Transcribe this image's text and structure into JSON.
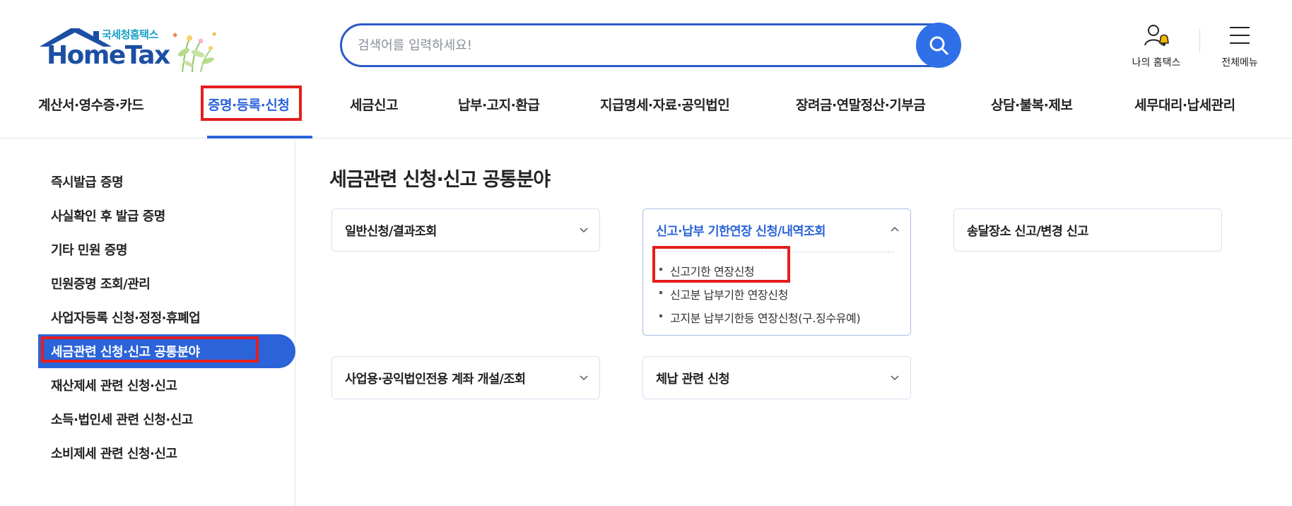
{
  "header": {
    "logo_sub": "국세청홈택스",
    "logo_main": "HomeTax",
    "search_placeholder": "검색어를 입력하세요!",
    "my_hometax": "나의 홈택스",
    "all_menu": "전체메뉴"
  },
  "gnb": [
    {
      "label": "계산서·영수증·카드"
    },
    {
      "label": "증명·등록·신청"
    },
    {
      "label": "세금신고"
    },
    {
      "label": "납부·고지·환급"
    },
    {
      "label": "지급명세·자료·공익법인"
    },
    {
      "label": "장려금·연말정산·기부금"
    },
    {
      "label": "상담·불복·제보"
    },
    {
      "label": "세무대리·납세관리"
    }
  ],
  "sidebar": [
    {
      "label": "즉시발급 증명"
    },
    {
      "label": "사실확인 후 발급 증명"
    },
    {
      "label": "기타 민원 증명"
    },
    {
      "label": "민원증명 조회/관리"
    },
    {
      "label": "사업자등록 신청·정정·휴폐업"
    },
    {
      "label": "세금관련 신청·신고 공통분야"
    },
    {
      "label": "재산제세 관련 신청·신고"
    },
    {
      "label": "소득·법인세 관련 신청·신고"
    },
    {
      "label": "소비제세 관련 신청·신고"
    }
  ],
  "main": {
    "title": "세금관련 신청·신고 공통분야",
    "cards": [
      {
        "title": "일반신청/결과조회"
      },
      {
        "title": "신고·납부 기한연장 신청/내역조회",
        "items": [
          "신고기한 연장신청",
          "신고분 납부기한 연장신청",
          "고지분 납부기한등 연장신청(구.징수유예)"
        ]
      },
      {
        "title": "송달장소 신고/변경 신고"
      },
      {
        "title": "사업용·공익법인전용 계좌 개설/조회"
      },
      {
        "title": "체납 관련 신청"
      }
    ]
  },
  "colors": {
    "accent": "#2b63d9",
    "highlight": "#e41e1e",
    "search_border": "#2b5bc7"
  }
}
